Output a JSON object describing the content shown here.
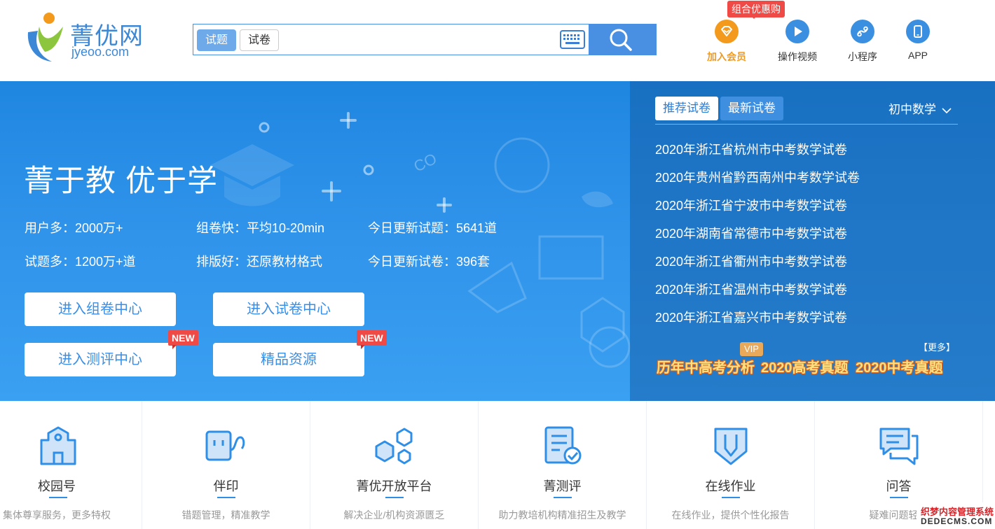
{
  "logo": {
    "cn": "菁优网",
    "en": "jyeoo.com"
  },
  "search": {
    "tabs": [
      "试题",
      "试卷"
    ],
    "placeholder": ""
  },
  "nav": {
    "combo_badge": "组合优惠购",
    "items": [
      {
        "label": "加入会员",
        "icon": "vip-diamond-icon"
      },
      {
        "label": "操作视频",
        "icon": "play-icon"
      },
      {
        "label": "小程序",
        "icon": "mini-program-icon"
      },
      {
        "label": "APP",
        "icon": "phone-icon"
      }
    ]
  },
  "banner": {
    "slogan": "菁于教 优于学",
    "stats": [
      "用户多：2000万+",
      "组卷快：平均10-20min",
      "今日更新试题：5641道",
      "试题多：1200万+道",
      "排版好：还原教材格式",
      "今日更新试卷：396套"
    ],
    "buttons": [
      "进入组卷中心",
      "进入试卷中心",
      "进入测评中心",
      "精品资源"
    ],
    "new_badge": "NEW"
  },
  "panel": {
    "tabs": [
      "推荐试卷",
      "最新试卷"
    ],
    "subject": "初中数学",
    "papers": [
      "2020年浙江省杭州市中考数学试卷",
      "2020年贵州省黔西南州中考数学试卷",
      "2020年浙江省宁波市中考数学试卷",
      "2020年湖南省常德市中考数学试卷",
      "2020年浙江省衢州市中考数学试卷",
      "2020年浙江省温州市中考数学试卷",
      "2020年浙江省嘉兴市中考数学试卷"
    ],
    "more": "【更多】",
    "vip": "VIP",
    "highlights": [
      "历年中高考分析",
      "2020高考真题",
      "2020中考真题"
    ]
  },
  "features": [
    {
      "title": "校园号",
      "desc": "集体尊享服务，更多特权",
      "icon": "school-icon"
    },
    {
      "title": "伴印",
      "desc": "错题管理，精准教学",
      "icon": "printer-icon"
    },
    {
      "title": "菁优开放平台",
      "desc": "解决企业/机构资源匮乏",
      "icon": "hexagons-icon"
    },
    {
      "title": "菁测评",
      "desc": "助力教培机构精准招生及教学",
      "icon": "checklist-icon"
    },
    {
      "title": "在线作业",
      "desc": "在线作业，提供个性化报告",
      "icon": "pencil-icon"
    },
    {
      "title": "问答",
      "desc": "疑难问题轻松",
      "icon": "chat-icon"
    }
  ],
  "watermark": {
    "line1": "织梦内容管理系统",
    "line2": "DEDECMS.COM"
  },
  "colors": {
    "brand": "#3d88d6",
    "banner": "#2f93ea",
    "vip": "#f39a1c",
    "badge": "#f04a47"
  }
}
